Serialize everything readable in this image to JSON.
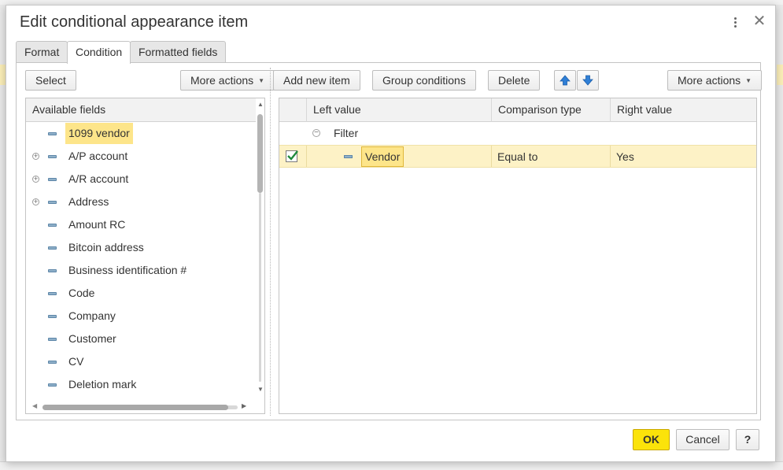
{
  "dialog": {
    "title": "Edit conditional appearance item",
    "tabs": [
      {
        "label": "Format",
        "active": false
      },
      {
        "label": "Condition",
        "active": true
      },
      {
        "label": "Formatted fields",
        "active": false
      }
    ]
  },
  "left_toolbar": {
    "select_label": "Select",
    "more_actions_label": "More actions"
  },
  "fields": {
    "header": "Available fields",
    "items": [
      {
        "label": "1099 vendor",
        "expandable": false,
        "selected": true
      },
      {
        "label": "A/P account",
        "expandable": true,
        "selected": false
      },
      {
        "label": "A/R account",
        "expandable": true,
        "selected": false
      },
      {
        "label": "Address",
        "expandable": true,
        "selected": false
      },
      {
        "label": "Amount RC",
        "expandable": false,
        "selected": false
      },
      {
        "label": "Bitcoin address",
        "expandable": false,
        "selected": false
      },
      {
        "label": "Business identification #",
        "expandable": false,
        "selected": false
      },
      {
        "label": "Code",
        "expandable": false,
        "selected": false
      },
      {
        "label": "Company",
        "expandable": false,
        "selected": false
      },
      {
        "label": "Customer",
        "expandable": false,
        "selected": false
      },
      {
        "label": "CV",
        "expandable": false,
        "selected": false
      },
      {
        "label": "Deletion mark",
        "expandable": false,
        "selected": false
      }
    ]
  },
  "right_toolbar": {
    "add_new_item_label": "Add new item",
    "group_conditions_label": "Group conditions",
    "delete_label": "Delete",
    "more_actions_label": "More actions"
  },
  "conditions": {
    "columns": {
      "left_value": "Left value",
      "comparison_type": "Comparison type",
      "right_value": "Right value"
    },
    "group_label": "Filter",
    "rows": [
      {
        "checked": true,
        "left_value": "Vendor",
        "comparison_type": "Equal to",
        "right_value": "Yes"
      }
    ]
  },
  "footer": {
    "ok_label": "OK",
    "cancel_label": "Cancel",
    "help_label": "?"
  },
  "colors": {
    "highlight": "#fde58a",
    "selected_row": "#fdf2c6",
    "ok_button": "#fbe30a",
    "check_mark": "#1f8a3c",
    "arrow_blue": "#2f7fd6"
  }
}
